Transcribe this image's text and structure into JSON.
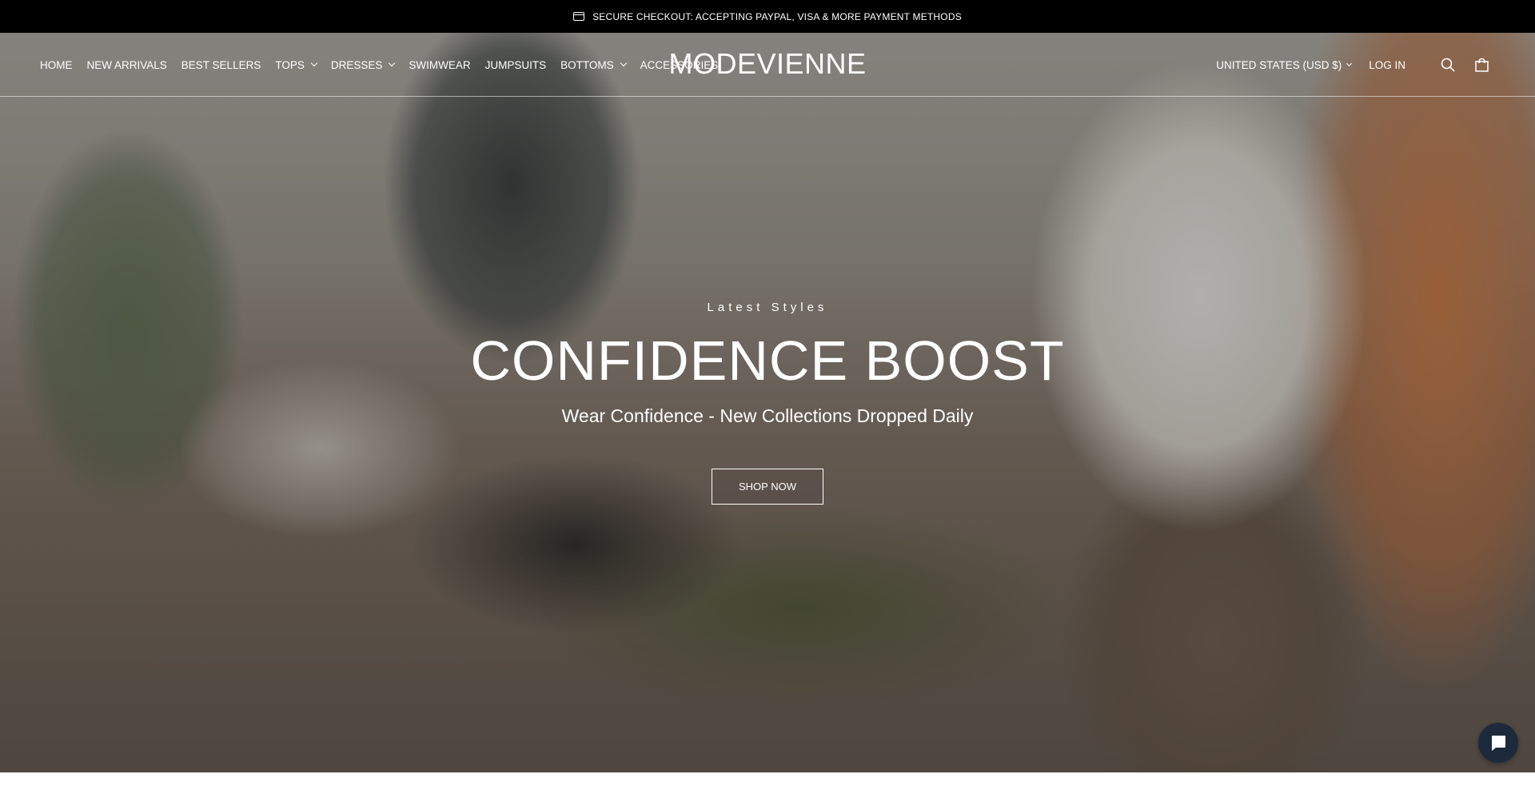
{
  "announcement": {
    "text": "SECURE CHECKOUT: ACCEPTING PAYPAL, VISA & MORE PAYMENT METHODS",
    "icon": "credit-card-icon"
  },
  "header": {
    "logo": "MODEVIENNE",
    "nav": [
      {
        "label": "HOME",
        "has_dropdown": false
      },
      {
        "label": "NEW ARRIVALS",
        "has_dropdown": false
      },
      {
        "label": "BEST SELLERS",
        "has_dropdown": false
      },
      {
        "label": "TOPS",
        "has_dropdown": true
      },
      {
        "label": "DRESSES",
        "has_dropdown": true
      },
      {
        "label": "SWIMWEAR",
        "has_dropdown": false
      },
      {
        "label": "JUMPSUITS",
        "has_dropdown": false
      },
      {
        "label": "BOTTOMS",
        "has_dropdown": true
      },
      {
        "label": "ACCESSORIES",
        "has_dropdown": false
      }
    ],
    "country_selector": "UNITED STATES (USD $)",
    "login": "LOG IN",
    "icons": [
      "search-icon",
      "cart-icon"
    ]
  },
  "hero": {
    "eyebrow": "Latest Styles",
    "headline": "CONFIDENCE BOOST",
    "subheadline": "Wear Confidence - New Collections Dropped Daily",
    "cta": "SHOP NOW"
  },
  "chat": {
    "icon": "chat-bubble-icon",
    "color": "#1d2a3b"
  },
  "colors": {
    "announcement_bg": "#000000",
    "text": "#ffffff"
  }
}
